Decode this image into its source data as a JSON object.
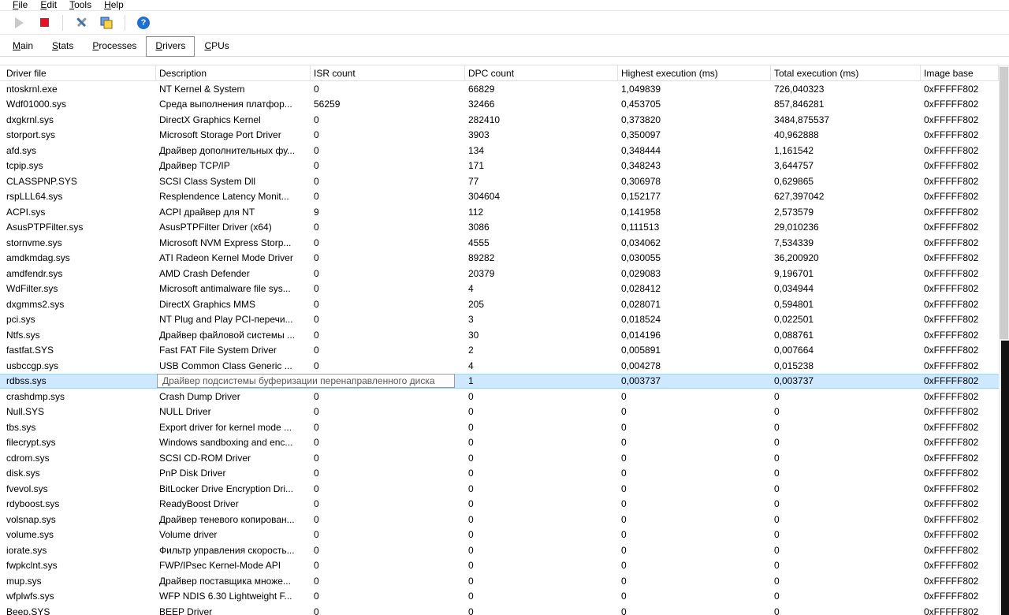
{
  "menu": {
    "items": [
      {
        "label": "File"
      },
      {
        "label": "Edit"
      },
      {
        "label": "Tools"
      },
      {
        "label": "Help"
      }
    ]
  },
  "toolbar": {
    "help_glyph": "?",
    "icons": [
      {
        "name": "play-icon",
        "meaning": "start monitor",
        "enabled": false
      },
      {
        "name": "stop-icon",
        "meaning": "stop monitor",
        "enabled": true
      },
      {
        "name": "tools-icon",
        "meaning": "options"
      },
      {
        "name": "windows-icon",
        "meaning": "report windows"
      },
      {
        "name": "help-icon",
        "meaning": "help"
      }
    ]
  },
  "tabs": [
    {
      "label": "Main",
      "active": false
    },
    {
      "label": "Stats",
      "active": false
    },
    {
      "label": "Processes",
      "active": false
    },
    {
      "label": "Drivers",
      "active": true
    },
    {
      "label": "CPUs",
      "active": false
    }
  ],
  "table": {
    "columns": [
      "Driver file",
      "Description",
      "ISR count",
      "DPC count",
      "Highest execution (ms)",
      "Total execution (ms)",
      "Image base"
    ],
    "rows": [
      {
        "driver": "ntoskrnl.exe",
        "description": "NT Kernel & System",
        "isr": "0",
        "dpc": "66829",
        "highest": "1,049839",
        "total": "726,040323",
        "base": "0xFFFFF802"
      },
      {
        "driver": "Wdf01000.sys",
        "description": "Среда выполнения платфор...",
        "isr": "56259",
        "dpc": "32466",
        "highest": "0,453705",
        "total": "857,846281",
        "base": "0xFFFFF802"
      },
      {
        "driver": "dxgkrnl.sys",
        "description": "DirectX Graphics Kernel",
        "isr": "0",
        "dpc": "282410",
        "highest": "0,373820",
        "total": "3484,875537",
        "base": "0xFFFFF802"
      },
      {
        "driver": "storport.sys",
        "description": "Microsoft Storage Port Driver",
        "isr": "0",
        "dpc": "3903",
        "highest": "0,350097",
        "total": "40,962888",
        "base": "0xFFFFF802"
      },
      {
        "driver": "afd.sys",
        "description": "Драйвер дополнительных фу...",
        "isr": "0",
        "dpc": "134",
        "highest": "0,348444",
        "total": "1,161542",
        "base": "0xFFFFF802"
      },
      {
        "driver": "tcpip.sys",
        "description": "Драйвер TCP/IP",
        "isr": "0",
        "dpc": "171",
        "highest": "0,348243",
        "total": "3,644757",
        "base": "0xFFFFF802"
      },
      {
        "driver": "CLASSPNP.SYS",
        "description": "SCSI Class System Dll",
        "isr": "0",
        "dpc": "77",
        "highest": "0,306978",
        "total": "0,629865",
        "base": "0xFFFFF802"
      },
      {
        "driver": "rspLLL64.sys",
        "description": "Resplendence Latency Monit...",
        "isr": "0",
        "dpc": "304604",
        "highest": "0,152177",
        "total": "627,397042",
        "base": "0xFFFFF802"
      },
      {
        "driver": "ACPI.sys",
        "description": "ACPI драйвер для NT",
        "isr": "9",
        "dpc": "112",
        "highest": "0,141958",
        "total": "2,573579",
        "base": "0xFFFFF802"
      },
      {
        "driver": "AsusPTPFilter.sys",
        "description": "AsusPTPFilter Driver (x64)",
        "isr": "0",
        "dpc": "3086",
        "highest": "0,111513",
        "total": "29,010236",
        "base": "0xFFFFF802"
      },
      {
        "driver": "stornvme.sys",
        "description": "Microsoft NVM Express Storp...",
        "isr": "0",
        "dpc": "4555",
        "highest": "0,034062",
        "total": "7,534339",
        "base": "0xFFFFF802"
      },
      {
        "driver": "amdkmdag.sys",
        "description": "ATI Radeon Kernel Mode Driver",
        "isr": "0",
        "dpc": "89282",
        "highest": "0,030055",
        "total": "36,200920",
        "base": "0xFFFFF802"
      },
      {
        "driver": "amdfendr.sys",
        "description": "AMD Crash Defender",
        "isr": "0",
        "dpc": "20379",
        "highest": "0,029083",
        "total": "9,196701",
        "base": "0xFFFFF802"
      },
      {
        "driver": "WdFilter.sys",
        "description": "Microsoft antimalware file sys...",
        "isr": "0",
        "dpc": "4",
        "highest": "0,028412",
        "total": "0,034944",
        "base": "0xFFFFF802"
      },
      {
        "driver": "dxgmms2.sys",
        "description": "DirectX Graphics MMS",
        "isr": "0",
        "dpc": "205",
        "highest": "0,028071",
        "total": "0,594801",
        "base": "0xFFFFF802"
      },
      {
        "driver": "pci.sys",
        "description": "NT Plug and Play PCI-перечи...",
        "isr": "0",
        "dpc": "3",
        "highest": "0,018524",
        "total": "0,022501",
        "base": "0xFFFFF802"
      },
      {
        "driver": "Ntfs.sys",
        "description": "Драйвер файловой системы ...",
        "isr": "0",
        "dpc": "30",
        "highest": "0,014196",
        "total": "0,088761",
        "base": "0xFFFFF802"
      },
      {
        "driver": "fastfat.SYS",
        "description": "Fast FAT File System Driver",
        "isr": "0",
        "dpc": "2",
        "highest": "0,005891",
        "total": "0,007664",
        "base": "0xFFFFF802"
      },
      {
        "driver": "usbccgp.sys",
        "description": "USB Common Class Generic ...",
        "isr": "0",
        "dpc": "4",
        "highest": "0,004278",
        "total": "0,015238",
        "base": "0xFFFFF802"
      },
      {
        "driver": "rdbss.sys",
        "description": "",
        "isr": "",
        "dpc": "1",
        "highest": "0,003737",
        "total": "0,003737",
        "base": "0xFFFFF802",
        "selected": true
      },
      {
        "driver": "crashdmp.sys",
        "description": "Crash Dump Driver",
        "isr": "0",
        "dpc": "0",
        "highest": "0",
        "total": "0",
        "base": "0xFFFFF802"
      },
      {
        "driver": "Null.SYS",
        "description": "NULL Driver",
        "isr": "0",
        "dpc": "0",
        "highest": "0",
        "total": "0",
        "base": "0xFFFFF802"
      },
      {
        "driver": "tbs.sys",
        "description": "Export driver for kernel mode ...",
        "isr": "0",
        "dpc": "0",
        "highest": "0",
        "total": "0",
        "base": "0xFFFFF802"
      },
      {
        "driver": "filecrypt.sys",
        "description": "Windows sandboxing and enc...",
        "isr": "0",
        "dpc": "0",
        "highest": "0",
        "total": "0",
        "base": "0xFFFFF802"
      },
      {
        "driver": "cdrom.sys",
        "description": "SCSI CD-ROM Driver",
        "isr": "0",
        "dpc": "0",
        "highest": "0",
        "total": "0",
        "base": "0xFFFFF802"
      },
      {
        "driver": "disk.sys",
        "description": "PnP Disk Driver",
        "isr": "0",
        "dpc": "0",
        "highest": "0",
        "total": "0",
        "base": "0xFFFFF802"
      },
      {
        "driver": "fvevol.sys",
        "description": "BitLocker Drive Encryption Dri...",
        "isr": "0",
        "dpc": "0",
        "highest": "0",
        "total": "0",
        "base": "0xFFFFF802"
      },
      {
        "driver": "rdyboost.sys",
        "description": "ReadyBoost Driver",
        "isr": "0",
        "dpc": "0",
        "highest": "0",
        "total": "0",
        "base": "0xFFFFF802"
      },
      {
        "driver": "volsnap.sys",
        "description": "Драйвер теневого копирован...",
        "isr": "0",
        "dpc": "0",
        "highest": "0",
        "total": "0",
        "base": "0xFFFFF802"
      },
      {
        "driver": "volume.sys",
        "description": "Volume driver",
        "isr": "0",
        "dpc": "0",
        "highest": "0",
        "total": "0",
        "base": "0xFFFFF802"
      },
      {
        "driver": "iorate.sys",
        "description": "Фильтр управления скорость...",
        "isr": "0",
        "dpc": "0",
        "highest": "0",
        "total": "0",
        "base": "0xFFFFF802"
      },
      {
        "driver": "fwpkclnt.sys",
        "description": "FWP/IPsec Kernel-Mode API",
        "isr": "0",
        "dpc": "0",
        "highest": "0",
        "total": "0",
        "base": "0xFFFFF802"
      },
      {
        "driver": "mup.sys",
        "description": "Драйвер поставщика множе...",
        "isr": "0",
        "dpc": "0",
        "highest": "0",
        "total": "0",
        "base": "0xFFFFF802"
      },
      {
        "driver": "wfplwfs.sys",
        "description": "WFP NDIS 6.30 Lightweight F...",
        "isr": "0",
        "dpc": "0",
        "highest": "0",
        "total": "0",
        "base": "0xFFFFF802"
      },
      {
        "driver": "Beep.SYS",
        "description": "BEEP Driver",
        "isr": "0",
        "dpc": "0",
        "highest": "0",
        "total": "0",
        "base": "0xFFFFF802"
      }
    ]
  },
  "tooltip": {
    "text": "Драйвер подсистемы буферизации перенаправленного диска"
  },
  "colors": {
    "selection": "#cde8ff",
    "stop_button": "#e81123",
    "help_button": "#1d6fd4",
    "tooltip_border": "#9b9b9b"
  }
}
